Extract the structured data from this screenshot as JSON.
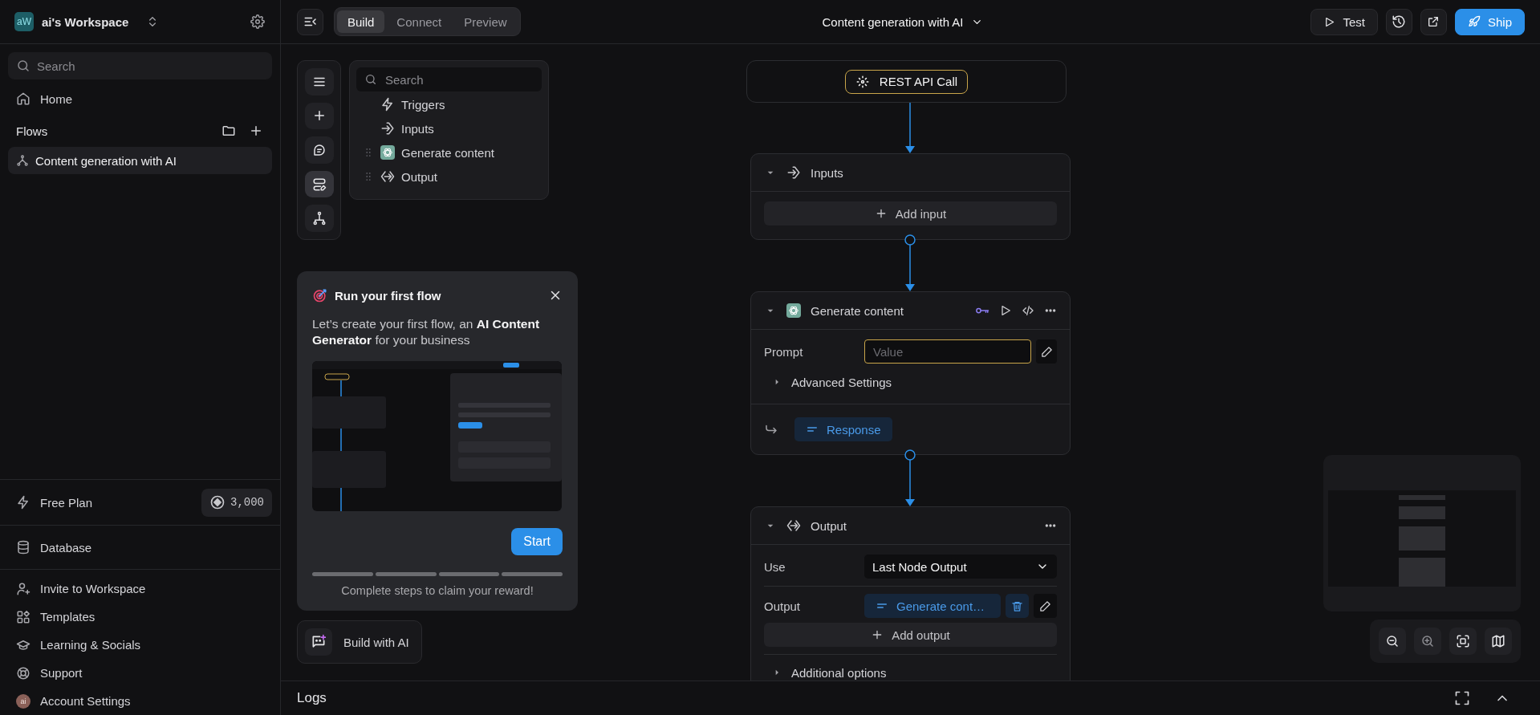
{
  "workspace": {
    "avatar": "aW",
    "name": "ai's Workspace"
  },
  "sidebar": {
    "search": {
      "placeholder": "Search"
    },
    "nav": [
      {
        "label": "Home"
      }
    ],
    "flows_title": "Flows",
    "flows": [
      {
        "label": "Content generation with AI",
        "selected": true
      }
    ],
    "plan": {
      "label": "Free Plan",
      "credits": "3,000"
    },
    "database": {
      "label": "Database"
    },
    "links": [
      {
        "label": "Invite to Workspace"
      },
      {
        "label": "Templates"
      },
      {
        "label": "Learning & Socials"
      },
      {
        "label": "Support"
      },
      {
        "label": "Account Settings",
        "avatar": "ai"
      }
    ]
  },
  "toolbar": {
    "tabs": [
      {
        "label": "Build",
        "selected": true
      },
      {
        "label": "Connect",
        "selected": false
      },
      {
        "label": "Preview",
        "selected": false
      }
    ],
    "title": "Content generation with AI",
    "actions": [
      {
        "kind": "test",
        "label": "Test"
      },
      {
        "kind": "history"
      },
      {
        "kind": "share"
      },
      {
        "kind": "ship",
        "label": "Ship"
      }
    ]
  },
  "tools": [
    {
      "selected": false
    },
    {
      "selected": false
    },
    {
      "selected": false
    },
    {
      "selected": true
    },
    {
      "selected": false
    }
  ],
  "outline": {
    "search": {
      "placeholder": "Search"
    },
    "items": [
      {
        "kind": "section",
        "label": "Triggers"
      },
      {
        "kind": "section",
        "label": "Inputs"
      },
      {
        "kind": "node",
        "label": "Generate content"
      },
      {
        "kind": "node",
        "label": "Output"
      }
    ]
  },
  "tutorial": {
    "title": "Run your first flow",
    "text": "Let’s create your first flow, an **AI Content Generator** for your business",
    "start": "Start",
    "steps": [
      {
        "done": false
      },
      {
        "done": false
      },
      {
        "done": false
      },
      {
        "done": false
      }
    ],
    "footer": "Complete steps to claim your reward!"
  },
  "build_ai": {
    "label": "Build with AI"
  },
  "flow": {
    "trigger": {
      "label": "REST API Call"
    },
    "nodes": [
      {
        "kind": "inputs",
        "title": "Inputs",
        "expanded": true,
        "add_label": "Add input"
      },
      {
        "kind": "llm",
        "title": "Generate content",
        "expanded": true,
        "prompt": {
          "label": "Prompt",
          "placeholder": "Value"
        },
        "advanced": {
          "label": "Advanced Settings",
          "expanded": false
        },
        "response": "Response"
      },
      {
        "kind": "output",
        "title": "Output",
        "expanded": true,
        "use": {
          "label": "Use",
          "value": "Last Node Output"
        },
        "output": {
          "label": "Output",
          "value": "Generate cont…"
        },
        "add_label": "Add output",
        "additional": {
          "label": "Additional options",
          "expanded": false
        }
      }
    ]
  },
  "logs": {
    "title": "Logs"
  }
}
